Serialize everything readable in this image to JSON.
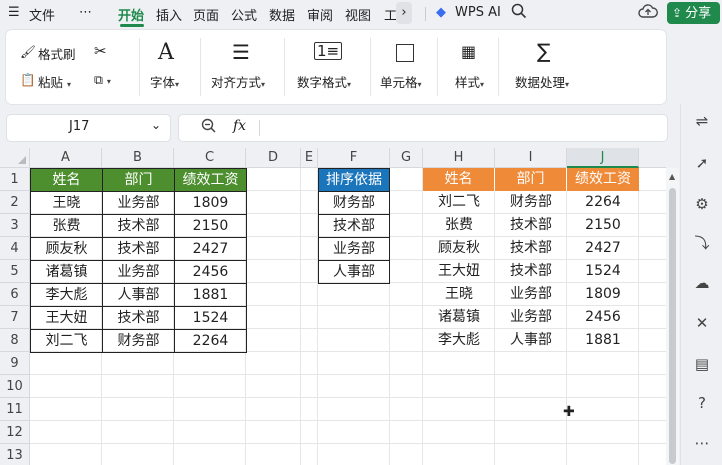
{
  "menubar": {
    "file": "文件",
    "more": "⋯",
    "tabs": [
      "开始",
      "插入",
      "页面",
      "公式",
      "数据",
      "审阅",
      "视图",
      "工"
    ],
    "active_tab": "开始",
    "wps_ai": "WPS AI",
    "share": "分享"
  },
  "ribbon": {
    "format_painter": "格式刷",
    "paste": "粘贴",
    "font": "字体",
    "align": "对齐方式",
    "number_format": "数字格式",
    "cell": "单元格",
    "style": "样式",
    "data_process": "数据处理"
  },
  "namebox": {
    "value": "J17"
  },
  "formula": {
    "fx": "fx",
    "value": ""
  },
  "sheet": {
    "columns": [
      "A",
      "B",
      "C",
      "D",
      "E",
      "F",
      "G",
      "H",
      "I",
      "J"
    ],
    "rows": [
      "1",
      "2",
      "3",
      "4",
      "5",
      "6",
      "7",
      "8",
      "9",
      "10",
      "11",
      "12",
      "13"
    ],
    "selected_column": "J",
    "table1": {
      "headers": [
        "姓名",
        "部门",
        "绩效工资"
      ],
      "rows": [
        [
          "王晓",
          "业务部",
          "1809"
        ],
        [
          "张费",
          "技术部",
          "2150"
        ],
        [
          "顾友秋",
          "技术部",
          "2427"
        ],
        [
          "诸葛镇",
          "业务部",
          "2456"
        ],
        [
          "李大彪",
          "人事部",
          "1881"
        ],
        [
          "王大妞",
          "技术部",
          "1524"
        ],
        [
          "刘二飞",
          "财务部",
          "2264"
        ]
      ]
    },
    "sort_key": {
      "header": "排序依据",
      "items": [
        "财务部",
        "技术部",
        "业务部",
        "人事部"
      ]
    },
    "table2": {
      "headers": [
        "姓名",
        "部门",
        "绩效工资"
      ],
      "rows": [
        [
          "刘二飞",
          "财务部",
          "2264"
        ],
        [
          "张费",
          "技术部",
          "2150"
        ],
        [
          "顾友秋",
          "技术部",
          "2427"
        ],
        [
          "王大妞",
          "技术部",
          "1524"
        ],
        [
          "王晓",
          "业务部",
          "1809"
        ],
        [
          "诸葛镇",
          "业务部",
          "2456"
        ],
        [
          "李大彪",
          "人事部",
          "1881"
        ]
      ]
    }
  },
  "colors": {
    "accent": "#1f8a4c",
    "green_header": "#4d8f2f",
    "blue_header": "#1b75bb",
    "orange_header": "#ef8a38"
  }
}
